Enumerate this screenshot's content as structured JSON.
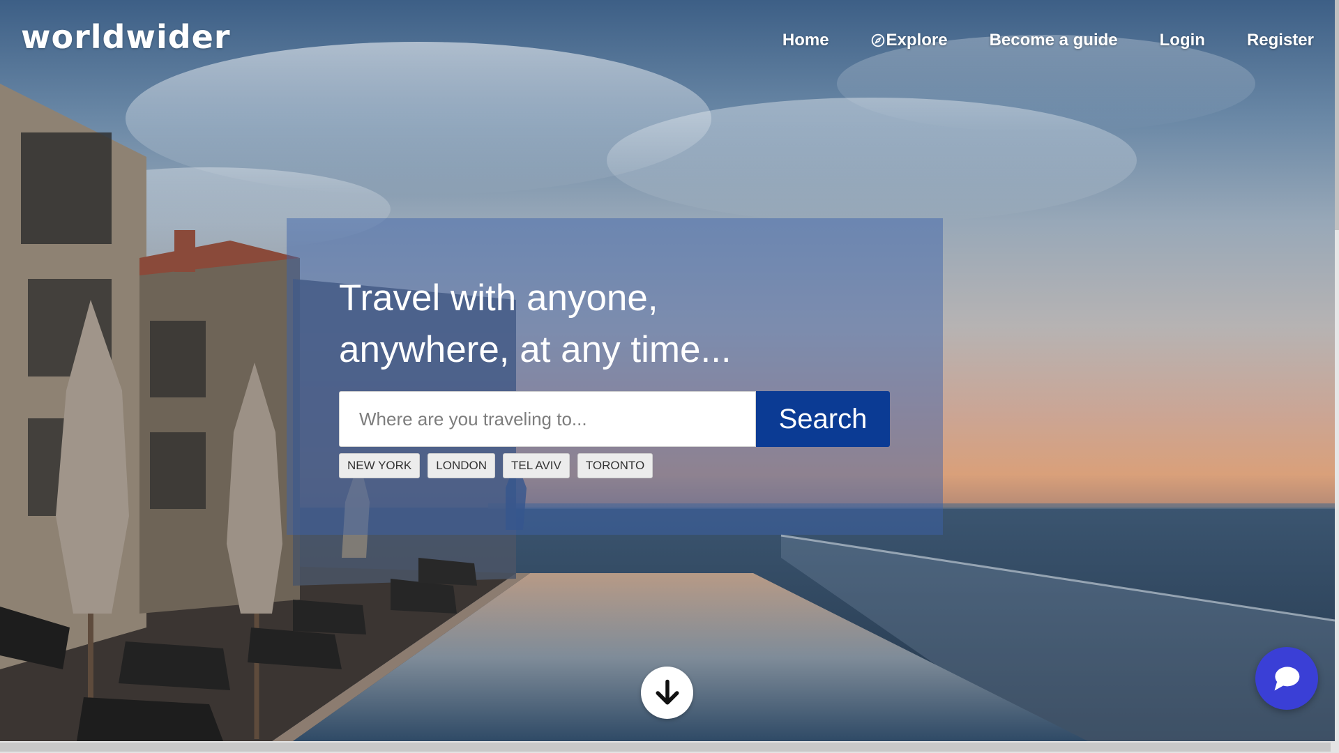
{
  "brand": {
    "logo_text": "worldwider"
  },
  "nav": {
    "items": [
      {
        "label": "Home"
      },
      {
        "label": "Explore",
        "icon": "compass-icon"
      },
      {
        "label": "Become a guide"
      },
      {
        "label": "Login"
      },
      {
        "label": "Register"
      }
    ]
  },
  "hero": {
    "title_line1": "Travel with anyone,",
    "title_line2": "anywhere, at any time...",
    "search": {
      "placeholder": "Where are you traveling to...",
      "value": "",
      "button_label": "Search"
    },
    "quick_destinations": [
      "NEW YORK",
      "LONDON",
      "TEL AVIV",
      "TORONTO"
    ]
  },
  "floating": {
    "scroll_icon": "arrow-down-icon",
    "chat_icon": "chat-bubble-icon"
  },
  "colors": {
    "hero_overlay": "#3c62aa",
    "search_button": "#0b3b94",
    "chat_button": "#3a3fd6",
    "text_light": "#ffffff"
  }
}
